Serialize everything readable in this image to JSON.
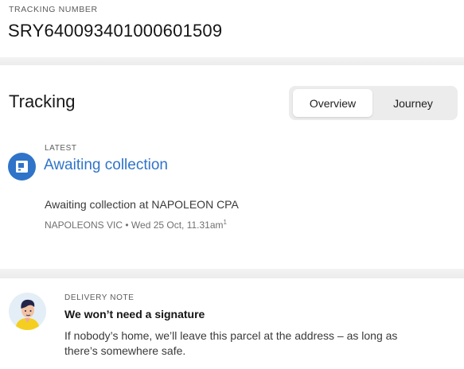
{
  "tracking_number": {
    "label": "TRACKING NUMBER",
    "value": "SRY640093401000601509"
  },
  "tracking": {
    "title": "Tracking",
    "tabs": [
      {
        "label": "Overview",
        "selected": true
      },
      {
        "label": "Journey",
        "selected": false
      }
    ]
  },
  "latest": {
    "label": "LATEST",
    "status": "Awaiting collection",
    "description": "Awaiting collection at NAPOLEON CPA",
    "location": "NAPOLEONS VIC",
    "separator": " • ",
    "datetime": "Wed 25 Oct, 11.31am",
    "footnote": "1",
    "icon": "parcel-locker-icon",
    "accent_color": "#2f74c9"
  },
  "delivery_note": {
    "label": "DELIVERY NOTE",
    "title": "We won’t need a signature",
    "body": "If nobody’s home, we’ll leave this parcel at the address – as long as there’s somewhere safe.",
    "avatar": "courier-avatar-icon"
  }
}
